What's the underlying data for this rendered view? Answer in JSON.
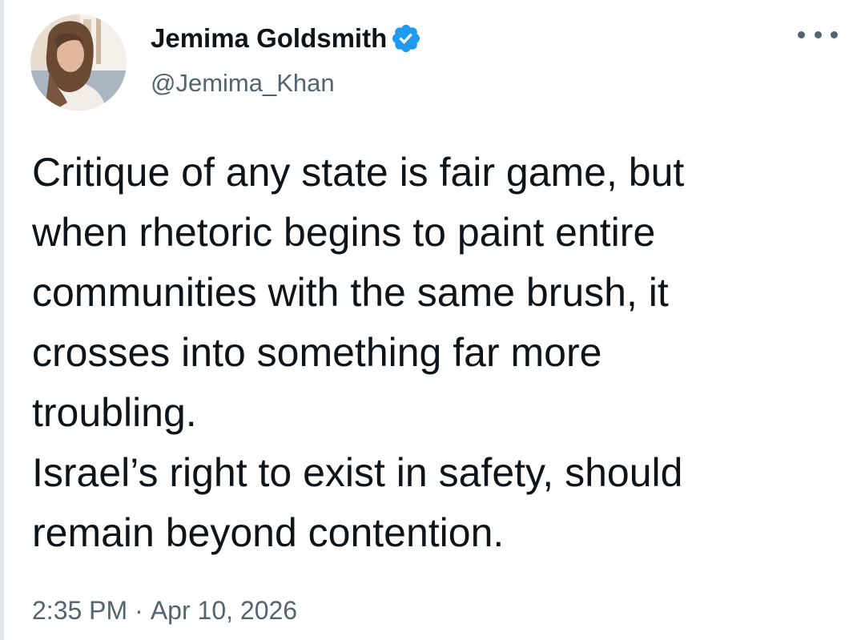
{
  "author": {
    "display_name": "Jemima Goldsmith",
    "handle": "@Jemima_Khan",
    "verified": true,
    "avatar_icon": "profile-photo"
  },
  "tweet": {
    "paragraphs": [
      "Critique of any state is fair game, but\nwhen rhetoric begins to paint entire\ncommunities with the same brush, it\ncrosses into something far more\ntroubling.",
      "Israel’s right to exist in safety, should\nremain beyond contention."
    ],
    "time": "2:35 PM",
    "separator": "·",
    "date": "Apr 10, 2026"
  },
  "icons": {
    "verified": "verified-badge-icon",
    "more": "more-options-icon"
  },
  "colors": {
    "text": "#0f1419",
    "secondary": "#536471",
    "verified_blue": "#1d9bf0",
    "background": "#ffffff"
  }
}
